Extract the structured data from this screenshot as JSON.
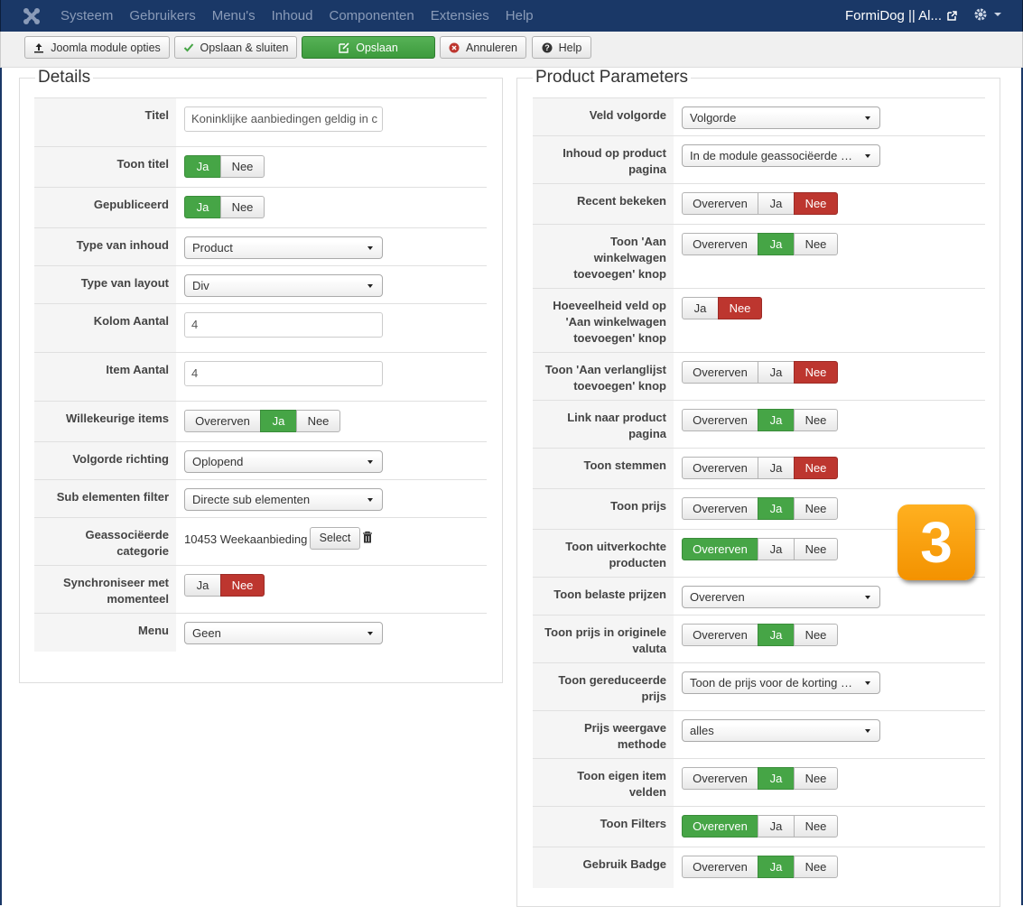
{
  "topbar": {
    "menu": [
      "Systeem",
      "Gebruikers",
      "Menu's",
      "Inhoud",
      "Componenten",
      "Extensies",
      "Help"
    ],
    "site_name": "FormiDog || Al..."
  },
  "toolbar": {
    "options_label": "Joomla module opties",
    "save_close_label": "Opslaan & sluiten",
    "save_label": "Opslaan",
    "cancel_label": "Annuleren",
    "help_label": "Help"
  },
  "details": {
    "legend": "Details",
    "titel_label": "Titel",
    "titel_value": "Koninklijke aanbiedingen geldig in c",
    "toon_titel_label": "Toon titel",
    "gepubliceerd_label": "Gepubliceerd",
    "type_inhoud_label": "Type van inhoud",
    "type_inhoud_value": "Product",
    "type_layout_label": "Type van layout",
    "type_layout_value": "Div",
    "kolom_label": "Kolom Aantal",
    "kolom_value": "4",
    "item_label": "Item Aantal",
    "item_value": "4",
    "willekeurig_label": "Willekeurige items",
    "volgorde_label": "Volgorde richting",
    "volgorde_value": "Oplopend",
    "sub_label": "Sub elementen filter",
    "sub_value": "Directe sub elementen",
    "cat_label_1": "Geassociëerde",
    "cat_label_2": "categorie",
    "cat_value": "10453 Weekaanbieding",
    "select_label": "Select",
    "sync_label_1": "Synchroniseer met",
    "sync_label_2": "momenteel",
    "menu_label": "Menu",
    "menu_value": "Geen"
  },
  "options": {
    "ja": "Ja",
    "nee": "Nee",
    "overerven": "Overerven"
  },
  "params": {
    "legend": "Product Parameters",
    "veld_label": "Veld volgorde",
    "veld_value": "Volgorde",
    "inhoud_label_1": "Inhoud op product",
    "inhoud_label_2": "pagina",
    "inhoud_value": "In de module geassociëerde categorie",
    "recent_label": "Recent bekeken",
    "winkel_label_1": "Toon 'Aan",
    "winkel_label_2": "winkelwagen",
    "winkel_label_3": "toevoegen' knop",
    "hoeveel_label_1": "Hoeveelheid veld op",
    "hoeveel_label_2": "'Aan winkelwagen",
    "hoeveel_label_3": "toevoegen' knop",
    "verlang_label_1": "Toon 'Aan verlanglijst",
    "verlang_label_2": "toevoegen' knop",
    "link_label_1": "Link naar product",
    "link_label_2": "pagina",
    "stemmen_label": "Toon stemmen",
    "prijs_label": "Toon prijs",
    "uitverkocht_label_1": "Toon uitverkochte",
    "uitverkocht_label_2": "producten",
    "belast_label": "Toon belaste prijzen",
    "belast_value": "Overerven",
    "valuta_label_1": "Toon prijs in originele",
    "valuta_label_2": "valuta",
    "gereduceerd_label_1": "Toon gereduceerde",
    "gereduceerd_label_2": "prijs",
    "gereduceerd_value": "Toon de prijs voor de korting en de kortingsprijs",
    "weergave_label_1": "Prijs weergave",
    "weergave_label_2": "methode",
    "weergave_value": "alles",
    "eigen_label_1": "Toon eigen item",
    "eigen_label_2": "velden",
    "filters_label": "Toon Filters",
    "badge_label": "Gebruik Badge"
  },
  "step_badge": "3"
}
